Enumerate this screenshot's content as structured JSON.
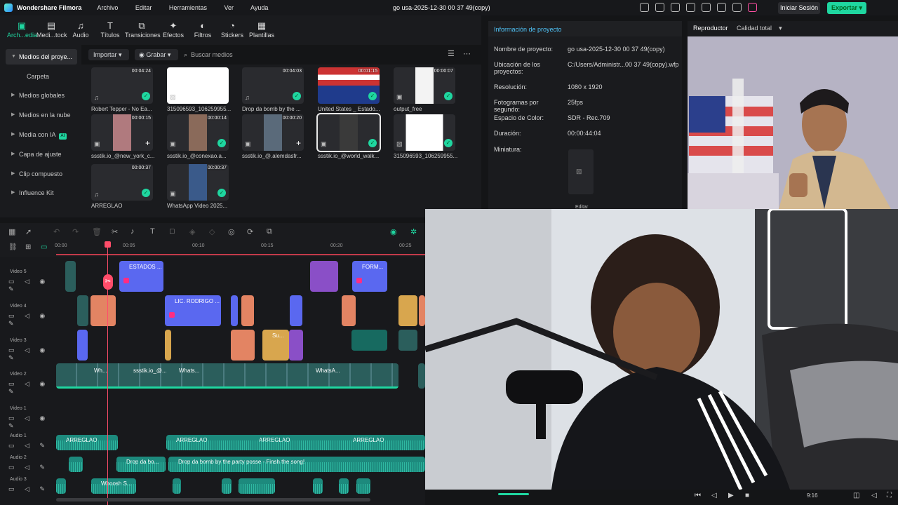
{
  "app": {
    "brand": "Wondershare Filmora",
    "menu": [
      "Archivo",
      "Editar",
      "Herramientas",
      "Ver",
      "Ayuda"
    ],
    "project_title": "go usa-2025-12-30 00 37 49(copy)",
    "login": "Iniciar Sesión",
    "export": "Exportar",
    "accent": "#1fd6a0"
  },
  "toolbar": [
    "Arch...edia",
    "Medi...tock",
    "Audio",
    "Títulos",
    "Transiciones",
    "Efectos",
    "Filtros",
    "Stickers",
    "Plantillas"
  ],
  "sidebar": {
    "items": [
      "Medios del proye...",
      "Carpeta",
      "Medios globales",
      "Medios en la nube",
      "Media con IA",
      "Capa de ajuste",
      "Clip compuesto",
      "Influence Kit"
    ],
    "ai_badge": "AI"
  },
  "media_head": {
    "import": "Importar",
    "record": "Grabar",
    "search_placeholder": "Buscar medios"
  },
  "media": [
    {
      "name": "Robert Tepper - No Ea...",
      "duration": "00:04:24"
    },
    {
      "name": "315096593_106259955...",
      "duration": ""
    },
    {
      "name": "Drop da bomb by the ...",
      "duration": "00:04:03"
    },
    {
      "name": "United States _ Estado...",
      "duration": "00:01:15"
    },
    {
      "name": "output_free",
      "duration": "00:00:07"
    },
    {
      "name": "ssstik.io_@new_york_c...",
      "duration": "00:00:15"
    },
    {
      "name": "ssstik.io_@conexao.a...",
      "duration": "00:00:14"
    },
    {
      "name": "ssstik.io_@.alemdasfr...",
      "duration": "00:00:20"
    },
    {
      "name": "ssstik.io_@world_walk...",
      "duration": ""
    },
    {
      "name": "315096593_106259955...",
      "duration": ""
    },
    {
      "name": "ARREGLAO",
      "duration": "00:00:37"
    },
    {
      "name": "WhatsApp Video 2025...",
      "duration": "00:00:37"
    }
  ],
  "info": {
    "header": "Información de proyecto",
    "rows": [
      {
        "label": "Nombre de proyecto:",
        "value": "go usa-2025-12-30 00 37 49(copy)"
      },
      {
        "label": "Ubicación de los proyectos:",
        "value": "C:/Users/Administr...00 37 49(copy).wfp"
      },
      {
        "label": "Resolución:",
        "value": "1080 x 1920"
      },
      {
        "label": "Fotogramas por segundo:",
        "value": "25fps"
      },
      {
        "label": "Espacio de Color:",
        "value": "SDR - Rec.709"
      },
      {
        "label": "Duración:",
        "value": "00:00:44:04"
      },
      {
        "label": "Miniatura:",
        "value": ""
      }
    ],
    "edit": "Editar"
  },
  "player": {
    "title": "Reproductor",
    "quality": "Calidad total",
    "ratio": "9:16"
  },
  "ruler": [
    "00:00",
    "00:05",
    "00:10",
    "00:15",
    "00:20",
    "00:25"
  ],
  "tracks": [
    "Video 5",
    "Video 4",
    "Video 3",
    "Video 2",
    "Video 1",
    "Audio 1",
    "Audio 2",
    "Audio 3"
  ],
  "clips": {
    "v5_a": "ESTADOS ...",
    "v5_b": "FORM...",
    "v4_a": "LIC. RODRIGO ...",
    "v3_a": "Su...",
    "v2_a": "Wh...",
    "v2_b": "ssstik.io_@...",
    "v2_c": "Whats...",
    "v2_d": "WhatsA...",
    "a1": "ARREGLAO",
    "a2_a": "Drop da bo...",
    "a2_b": "Drop da bomb by the party posse - Finsh the song!",
    "a3": "Whoosh S..."
  }
}
